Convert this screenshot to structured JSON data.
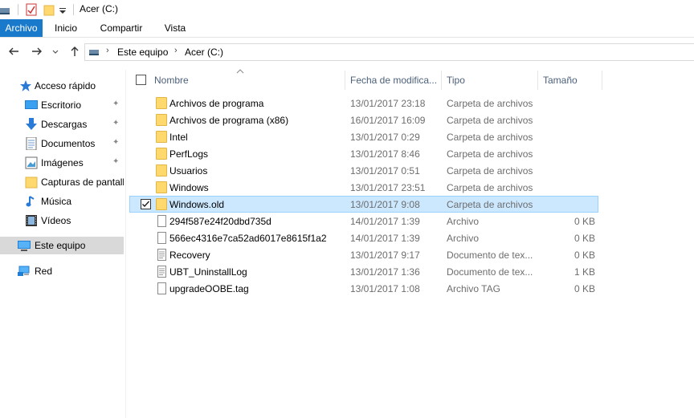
{
  "window": {
    "title": "Acer (C:)"
  },
  "ribbon": {
    "tabs": [
      "Archivo",
      "Inicio",
      "Compartir",
      "Vista"
    ]
  },
  "address": {
    "crumbs": [
      "Este equipo",
      "Acer (C:)"
    ]
  },
  "navpane": {
    "quick_access": "Acceso rápido",
    "items": [
      {
        "label": "Escritorio",
        "icon": "desktop-icon",
        "pinned": true
      },
      {
        "label": "Descargas",
        "icon": "downloads-icon",
        "pinned": true
      },
      {
        "label": "Documentos",
        "icon": "documents-icon",
        "pinned": true
      },
      {
        "label": "Imágenes",
        "icon": "pictures-icon",
        "pinned": true
      },
      {
        "label": "Capturas de pantall",
        "icon": "folder-icon",
        "pinned": false
      },
      {
        "label": "Música",
        "icon": "music-icon",
        "pinned": false
      },
      {
        "label": "Vídeos",
        "icon": "videos-icon",
        "pinned": false
      }
    ],
    "this_pc": "Este equipo",
    "network": "Red"
  },
  "columns": {
    "name": "Nombre",
    "date": "Fecha de modifica...",
    "type": "Tipo",
    "size": "Tamaño"
  },
  "files": [
    {
      "name": "Archivos de programa",
      "date": "13/01/2017 23:18",
      "type": "Carpeta de archivos",
      "size": "",
      "kind": "folder"
    },
    {
      "name": "Archivos de programa (x86)",
      "date": "16/01/2017 16:09",
      "type": "Carpeta de archivos",
      "size": "",
      "kind": "folder"
    },
    {
      "name": "Intel",
      "date": "13/01/2017 0:29",
      "type": "Carpeta de archivos",
      "size": "",
      "kind": "folder"
    },
    {
      "name": "PerfLogs",
      "date": "13/01/2017 8:46",
      "type": "Carpeta de archivos",
      "size": "",
      "kind": "folder"
    },
    {
      "name": "Usuarios",
      "date": "13/01/2017 0:51",
      "type": "Carpeta de archivos",
      "size": "",
      "kind": "folder"
    },
    {
      "name": "Windows",
      "date": "13/01/2017 23:51",
      "type": "Carpeta de archivos",
      "size": "",
      "kind": "folder"
    },
    {
      "name": "Windows.old",
      "date": "13/01/2017 9:08",
      "type": "Carpeta de archivos",
      "size": "",
      "kind": "folder",
      "selected": true
    },
    {
      "name": "294f587e24f20dbd735d",
      "date": "14/01/2017 1:39",
      "type": "Archivo",
      "size": "0 KB",
      "kind": "file"
    },
    {
      "name": "566ec4316e7ca52ad6017e8615f1a2",
      "date": "14/01/2017 1:39",
      "type": "Archivo",
      "size": "0 KB",
      "kind": "file"
    },
    {
      "name": "Recovery",
      "date": "13/01/2017 9:17",
      "type": "Documento de tex...",
      "size": "0 KB",
      "kind": "text"
    },
    {
      "name": "UBT_UninstallLog",
      "date": "13/01/2017 1:36",
      "type": "Documento de tex...",
      "size": "1 KB",
      "kind": "text"
    },
    {
      "name": "upgradeOOBE.tag",
      "date": "13/01/2017 1:08",
      "type": "Archivo TAG",
      "size": "0 KB",
      "kind": "file"
    }
  ]
}
